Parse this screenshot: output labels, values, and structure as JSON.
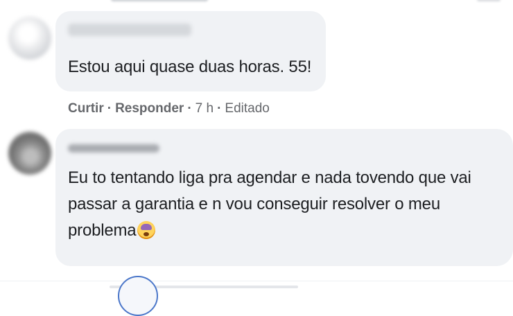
{
  "comments": [
    {
      "text": "Estou aqui quase duas horas. 55!",
      "actions": {
        "like_label": "Curtir",
        "reply_label": "Responder",
        "separator": "·",
        "time": "7 h",
        "edited": "Editado"
      }
    },
    {
      "text": "Eu to tentando liga pra agendar e nada tovendo que vai passar a garantia e n vou conseguir resolver o meu problema",
      "emoji": "weary-face-emoji"
    }
  ],
  "colors": {
    "bubble_bg": "#f0f2f5",
    "text": "#1c1e21",
    "secondary_text": "#65676b"
  }
}
